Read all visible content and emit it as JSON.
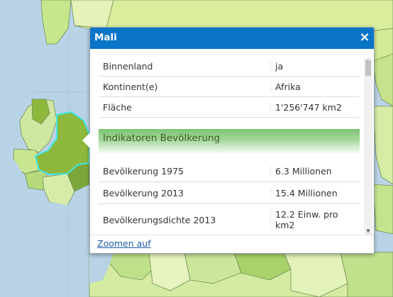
{
  "popup": {
    "title": "Mali",
    "close_symbol": "×",
    "attributes": [
      {
        "key": "Binnenland",
        "value": "ja"
      },
      {
        "key": "Kontinent(e)",
        "value": "Afrika"
      },
      {
        "key": "Fläche",
        "value": "1'256'747 km2"
      }
    ],
    "section_title": "Indikatoren Bevölkerung",
    "indicators": [
      {
        "key": "Bevölkerung 1975",
        "value": "6.3 Millionen"
      },
      {
        "key": "Bevölkerung 2013",
        "value": "15.4 Millionen"
      },
      {
        "key": "Bevölkerungsdichte 2013",
        "value": "12.2 Einw. pro km2"
      }
    ],
    "zoom_label": "Zoomen auf"
  },
  "scrollbar": {
    "up_icon": "triangle-up-icon",
    "down_icon": "triangle-down-icon"
  },
  "colors": {
    "header": "#0a74c7",
    "selected_country_fill": "#8db83c",
    "selected_country_outline": "#3fe6e6",
    "ocean": "#b9d3e6"
  }
}
